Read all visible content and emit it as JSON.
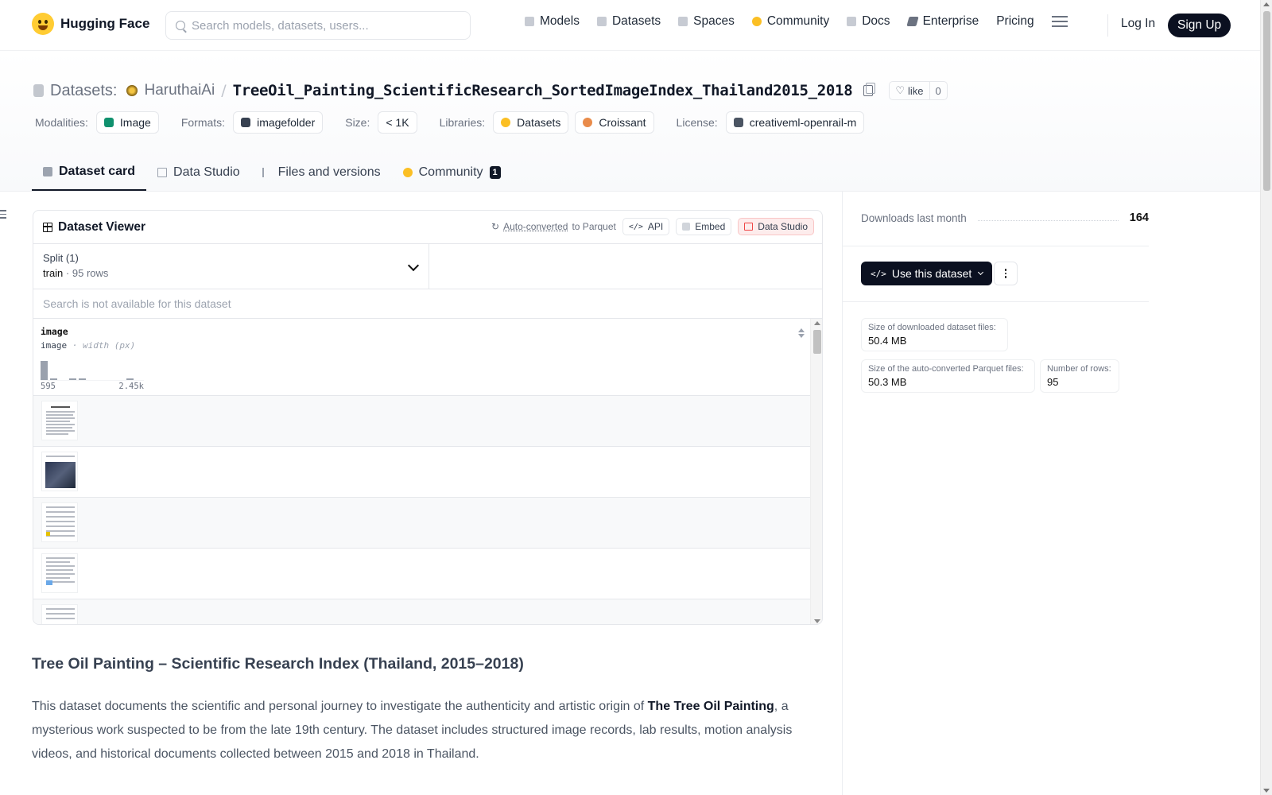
{
  "nav": {
    "brand": "Hugging Face",
    "search_placeholder": "Search models, datasets, users...",
    "links": [
      "Models",
      "Datasets",
      "Spaces",
      "Community",
      "Docs",
      "Enterprise",
      "Pricing"
    ],
    "login": "Log In",
    "signup": "Sign Up"
  },
  "header": {
    "section": "Datasets:",
    "owner": "HaruthaiAi",
    "separator": "/",
    "repo": "TreeOil_Painting_ScientificResearch_SortedImageIndex_Thailand2015_2018",
    "like_label": "like",
    "like_count": "0"
  },
  "meta": {
    "modalities_label": "Modalities:",
    "modality": "Image",
    "formats_label": "Formats:",
    "format": "imagefolder",
    "size_label": "Size:",
    "size": "< 1K",
    "libraries_label": "Libraries:",
    "library_1": "Datasets",
    "library_2": "Croissant",
    "license_label": "License:",
    "license": "creativeml-openrail-m"
  },
  "tabs": [
    {
      "label": "Dataset card",
      "active": true
    },
    {
      "label": "Data Studio"
    },
    {
      "label": "Files and versions"
    },
    {
      "label": "Community",
      "badge": "1"
    }
  ],
  "viewer": {
    "title": "Dataset Viewer",
    "autoconv_link": "Auto-converted",
    "autoconv_suffix": "to Parquet",
    "api": "API",
    "embed": "Embed",
    "data_studio": "Data Studio",
    "split_label": "Split (1)",
    "split_name": "train",
    "split_dot": "·",
    "split_rows": "95 rows",
    "search_disabled": "Search is not available for this dataset",
    "column": {
      "name": "image",
      "type": "image",
      "type_sep": " · ",
      "stat": "width (px)",
      "hist_min": "595",
      "hist_max": "2.45k",
      "hist_values": [
        1.0,
        0.08,
        0.0,
        0.08,
        0.08,
        0.0,
        0.0,
        0.0,
        0.0,
        0.06
      ]
    }
  },
  "readme": {
    "title": "Tree Oil Painting – Scientific Research Index (Thailand, 2015–2018)",
    "intro_1": "This dataset documents the scientific and personal journey to investigate the authenticity and artistic origin of ",
    "intro_bold": "The Tree Oil Painting",
    "intro_2": ", a mysterious work suspected to be from the late 19th century. The dataset includes structured image records, lab results, motion analysis videos, and historical documents collected between 2015 and 2018 in Thailand."
  },
  "sidebar": {
    "downloads_label": "Downloads last month",
    "downloads": "164",
    "use_button": "Use this dataset",
    "downloaded_size_label": "Size of downloaded dataset files:",
    "downloaded_size": "50.4 MB",
    "parquet_size_label": "Size of the auto-converted Parquet files:",
    "parquet_size": "50.3 MB",
    "rows_label": "Number of rows:",
    "rows": "95"
  }
}
